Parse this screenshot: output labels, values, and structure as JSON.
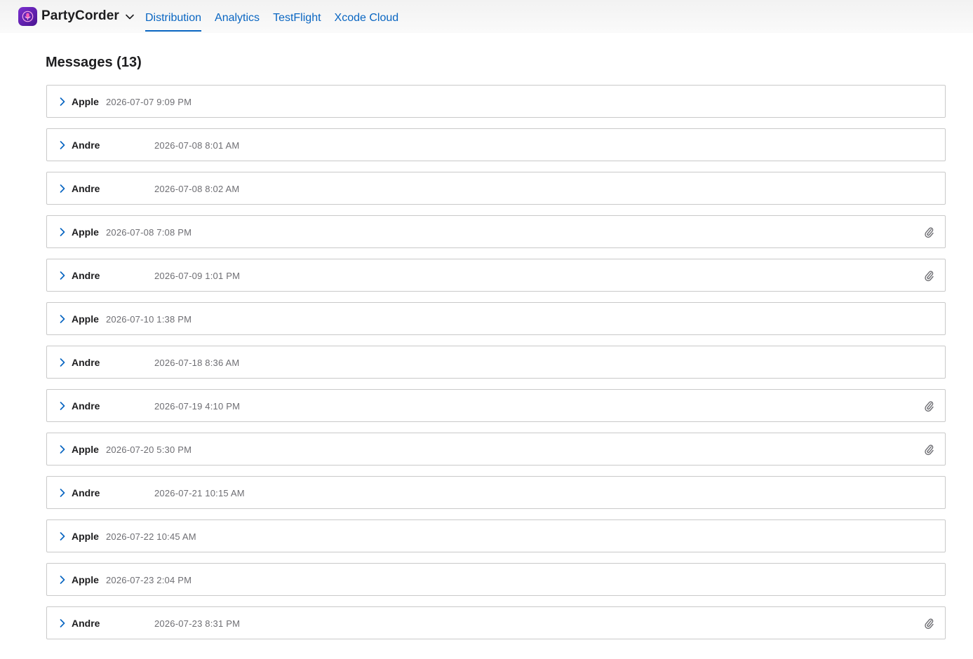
{
  "header": {
    "app_name": "PartyCorder",
    "tabs": [
      {
        "label": "Distribution",
        "active": true
      },
      {
        "label": "Analytics",
        "active": false
      },
      {
        "label": "TestFlight",
        "active": false
      },
      {
        "label": "Xcode Cloud",
        "active": false
      }
    ]
  },
  "colors": {
    "link": "#0a66c2",
    "app_icon": "#5b1fae"
  },
  "messages_section": {
    "title": "Messages (13)"
  },
  "messages": [
    {
      "sender": "Apple",
      "date": "2026-07-07 9:09 PM",
      "attachment": false
    },
    {
      "sender": "Andre",
      "date": "2026-07-08 8:01 AM",
      "attachment": false
    },
    {
      "sender": "Andre",
      "date": "2026-07-08 8:02 AM",
      "attachment": false
    },
    {
      "sender": "Apple",
      "date": "2026-07-08 7:08 PM",
      "attachment": true
    },
    {
      "sender": "Andre",
      "date": "2026-07-09 1:01 PM",
      "attachment": true
    },
    {
      "sender": "Apple",
      "date": "2026-07-10 1:38 PM",
      "attachment": false
    },
    {
      "sender": "Andre",
      "date": "2026-07-18 8:36 AM",
      "attachment": false
    },
    {
      "sender": "Andre",
      "date": "2026-07-19 4:10 PM",
      "attachment": true
    },
    {
      "sender": "Apple",
      "date": "2026-07-20 5:30 PM",
      "attachment": true
    },
    {
      "sender": "Andre",
      "date": "2026-07-21 10:15 AM",
      "attachment": false
    },
    {
      "sender": "Apple",
      "date": "2026-07-22 10:45 AM",
      "attachment": false
    },
    {
      "sender": "Apple",
      "date": "2026-07-23 2:04 PM",
      "attachment": false
    },
    {
      "sender": "Andre",
      "date": "2026-07-23 8:31 PM",
      "attachment": true
    }
  ]
}
